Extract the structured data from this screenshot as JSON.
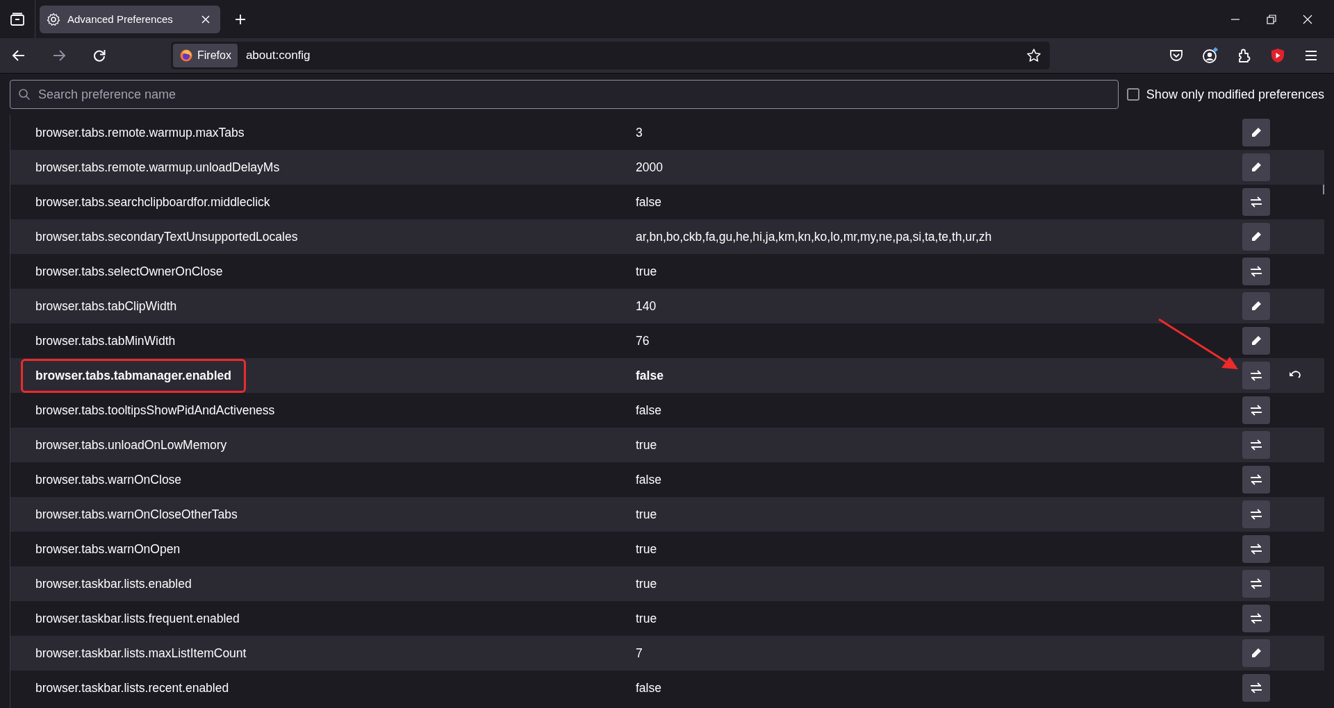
{
  "tab": {
    "title": "Advanced Preferences",
    "selected": true
  },
  "url_bar": {
    "identity": "Firefox",
    "url": "about:config"
  },
  "search": {
    "placeholder": "Search preference name"
  },
  "modified_filter": {
    "label": "Show only modified preferences",
    "checked": false
  },
  "rows": [
    {
      "name": "browser.tabs.remote.warmup.maxTabs",
      "value": "3",
      "kind": "edit",
      "modified": false,
      "annotated": false
    },
    {
      "name": "browser.tabs.remote.warmup.unloadDelayMs",
      "value": "2000",
      "kind": "edit",
      "modified": false,
      "annotated": false
    },
    {
      "name": "browser.tabs.searchclipboardfor.middleclick",
      "value": "false",
      "kind": "toggle",
      "modified": false,
      "annotated": false
    },
    {
      "name": "browser.tabs.secondaryTextUnsupportedLocales",
      "value": "ar,bn,bo,ckb,fa,gu,he,hi,ja,km,kn,ko,lo,mr,my,ne,pa,si,ta,te,th,ur,zh",
      "kind": "edit",
      "modified": false,
      "annotated": false
    },
    {
      "name": "browser.tabs.selectOwnerOnClose",
      "value": "true",
      "kind": "toggle",
      "modified": false,
      "annotated": false
    },
    {
      "name": "browser.tabs.tabClipWidth",
      "value": "140",
      "kind": "edit",
      "modified": false,
      "annotated": false
    },
    {
      "name": "browser.tabs.tabMinWidth",
      "value": "76",
      "kind": "edit",
      "modified": false,
      "annotated": false
    },
    {
      "name": "browser.tabs.tabmanager.enabled",
      "value": "false",
      "kind": "toggle",
      "modified": true,
      "annotated": true
    },
    {
      "name": "browser.tabs.tooltipsShowPidAndActiveness",
      "value": "false",
      "kind": "toggle",
      "modified": false,
      "annotated": false
    },
    {
      "name": "browser.tabs.unloadOnLowMemory",
      "value": "true",
      "kind": "toggle",
      "modified": false,
      "annotated": false
    },
    {
      "name": "browser.tabs.warnOnClose",
      "value": "false",
      "kind": "toggle",
      "modified": false,
      "annotated": false
    },
    {
      "name": "browser.tabs.warnOnCloseOtherTabs",
      "value": "true",
      "kind": "toggle",
      "modified": false,
      "annotated": false
    },
    {
      "name": "browser.tabs.warnOnOpen",
      "value": "true",
      "kind": "toggle",
      "modified": false,
      "annotated": false
    },
    {
      "name": "browser.taskbar.lists.enabled",
      "value": "true",
      "kind": "toggle",
      "modified": false,
      "annotated": false
    },
    {
      "name": "browser.taskbar.lists.frequent.enabled",
      "value": "true",
      "kind": "toggle",
      "modified": false,
      "annotated": false
    },
    {
      "name": "browser.taskbar.lists.maxListItemCount",
      "value": "7",
      "kind": "edit",
      "modified": false,
      "annotated": false
    },
    {
      "name": "browser.taskbar.lists.recent.enabled",
      "value": "false",
      "kind": "toggle",
      "modified": false,
      "annotated": false
    }
  ]
}
